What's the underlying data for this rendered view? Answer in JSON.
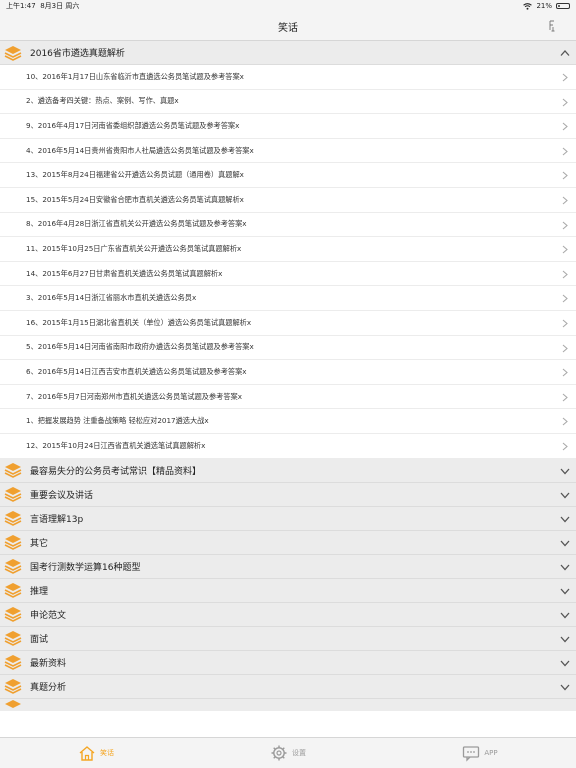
{
  "status": {
    "time": "上午1:47",
    "date": "8月3日 周六",
    "battery": "21%",
    "battery_level": 0.21
  },
  "nav": {
    "title": "笑话",
    "right_icon": "settings-icon"
  },
  "expanded_section": {
    "title": "2016省市遴选真题解析",
    "items": [
      "10、2016年1月17日山东省临沂市直遴选公务员笔试题及参考答案x",
      "2、遴选备考四关键：热点、案例、写作、真题x",
      "9、2016年4月17日河南省委组织部遴选公务员笔试题及参考答案x",
      "4、2016年5月14日贵州省贵阳市人社局遴选公务员笔试题及参考答案x",
      "13、2015年8月24日福建省公开遴选公务员试题（通用卷）真题解x",
      "15、2015年5月24日安徽省合肥市直机关遴选公务员笔试真题解析x",
      "8、2016年4月28日浙江省直机关公开遴选公务员笔试题及参考答案x",
      "11、2015年10月25日广东省直机关公开遴选公务员笔试真题解析x",
      "14、2015年6月27日甘肃省直机关遴选公务员笔试真题解析x",
      "3、2016年5月14日浙江省丽水市直机关遴选公务员x",
      "16、2015年1月15日湖北省直机关（单位）遴选公务员笔试真题解析x",
      "5、2016年5月14日河南省南阳市政府办遴选公务员笔试题及参考答案x",
      "6、2016年5月14日江西吉安市直机关遴选公务员笔试题及参考答案x",
      "7、2016年5月7日河南郑州市直机关遴选公务员笔试题及参考答案x",
      "1、把握发展趋势 注重备战策略 轻松应对2017遴选大战x",
      "12、2015年10月24日江西省直机关遴选笔试真题解析x"
    ]
  },
  "collapsed_sections": [
    "最容易失分的公务员考试常识【精品资料】",
    "重要会议及讲话",
    "言语理解13p",
    "其它",
    "国考行测数学运算16种题型",
    "推理",
    "申论范文",
    "面试",
    "最新资料",
    "真题分析"
  ],
  "tabs": [
    {
      "label": "笑话",
      "icon": "home-icon",
      "active": true
    },
    {
      "label": "设置",
      "icon": "gear-icon",
      "active": false
    },
    {
      "label": "APP",
      "icon": "chat-icon",
      "active": false
    }
  ],
  "colors": {
    "accent": "#f5a623",
    "stack_icon": "#f0a030",
    "tab_inactive": "#9a9a9a"
  }
}
